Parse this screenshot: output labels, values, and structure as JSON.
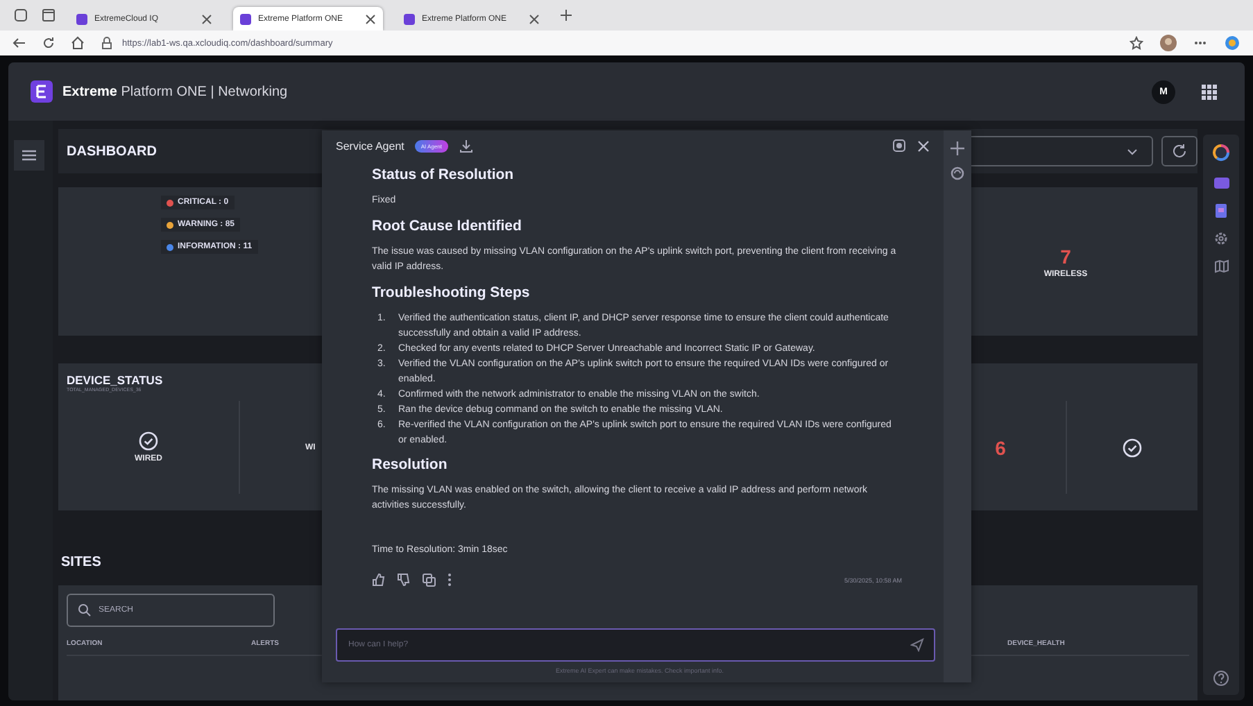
{
  "browser": {
    "tabs": [
      {
        "title": "ExtremeCloud IQ",
        "selected": false
      },
      {
        "title": "Extreme Platform ONE",
        "selected": true
      },
      {
        "title": "Extreme Platform ONE",
        "selected": false
      }
    ],
    "url": "https://lab1-ws.qa.xcloudiq.com/dashboard/summary"
  },
  "app": {
    "title": "**Extreme** Platform ONE | Networking",
    "avatar": "M"
  },
  "dashboard": {
    "title": "DASHBOARD",
    "alerts": [
      {
        "label": "CRITICAL : 0",
        "color": "#e0524f"
      },
      {
        "label": "WARNING : 85",
        "color": "#e8a33a"
      },
      {
        "label": "INFORMATION : 11",
        "color": "#4a86e8"
      }
    ],
    "wireless": {
      "value": "7",
      "label": "WIRELESS"
    },
    "device_status": {
      "title": "DEVICE_STATUS",
      "subtitle": "TOTAL_MANAGED_DEVICES_36",
      "cells": [
        {
          "kind": "check",
          "label": "WIRED"
        },
        {
          "kind": "label",
          "label": "WI"
        },
        {
          "kind": "count",
          "value": "6"
        },
        {
          "kind": "check"
        }
      ]
    },
    "sites": {
      "title": "SITES",
      "search_placeholder": "SEARCH",
      "columns": [
        "LOCATION",
        "ALERTS",
        "DEVICE_HEALTH"
      ]
    }
  },
  "agent": {
    "title": "Service Agent",
    "badge": "AI Agent",
    "blocks": [
      {
        "kind": "heading",
        "text": "Status of Resolution"
      },
      {
        "kind": "text",
        "text": "Fixed"
      },
      {
        "kind": "heading",
        "text": "Root Cause Identified"
      },
      {
        "kind": "text",
        "text": "The issue was caused by missing VLAN configuration on the AP's uplink switch port, preventing the client from receiving a valid IP address."
      },
      {
        "kind": "heading",
        "text": "Troubleshooting Steps"
      },
      {
        "kind": "list",
        "items": [
          {
            "number": "1.",
            "text": "Verified the authentication status, client IP, and DHCP server response time to ensure the client could authenticate successfully and obtain a valid IP address."
          },
          {
            "number": "2.",
            "text": "Checked for any events related to DHCP Server Unreachable and Incorrect Static IP or Gateway."
          },
          {
            "number": "3.",
            "text": "Verified the VLAN configuration on the AP's uplink switch port to ensure the required VLAN IDs were configured or enabled."
          },
          {
            "number": "4.",
            "text": "Confirmed with the network administrator to enable the missing VLAN on the switch."
          },
          {
            "number": "5.",
            "text": "Ran the device debug command on the switch to enable the missing VLAN."
          },
          {
            "number": "6.",
            "text": "Re-verified the VLAN configuration on the AP's uplink switch port to ensure the required VLAN IDs were configured or enabled."
          }
        ]
      },
      {
        "kind": "heading",
        "text": "Resolution"
      },
      {
        "kind": "text",
        "text": "The missing VLAN was enabled on the switch, allowing the client to receive a valid IP address and perform network activities successfully."
      },
      {
        "kind": "note",
        "text": "Time to Resolution: 3min 18sec"
      }
    ],
    "timestamp": "5/30/2025, 10:58 AM",
    "input_placeholder": "How can I help?",
    "disclaimer": "Extreme AI Expert can make mistakes. Check important info."
  }
}
